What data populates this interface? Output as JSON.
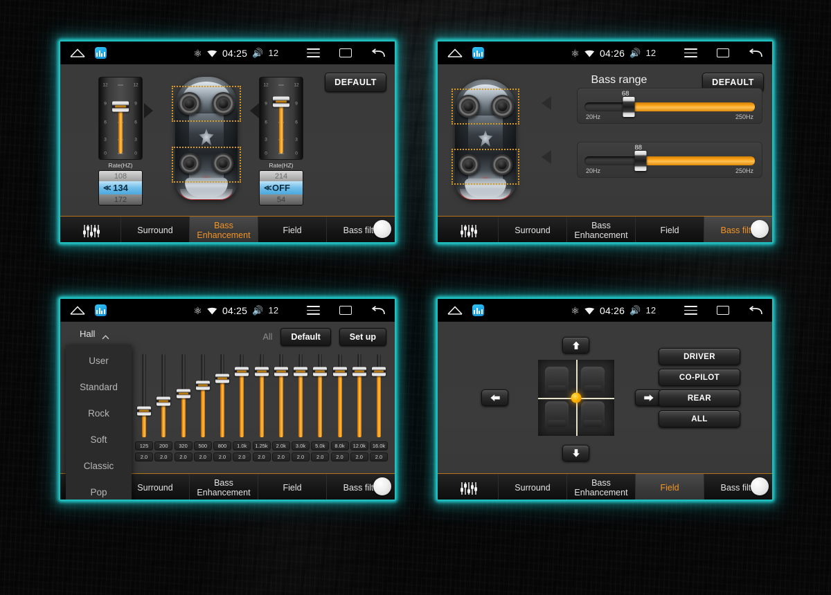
{
  "statusbar": {
    "home_icon": "home-icon",
    "app_icon": "equalizer-app-icon",
    "bluetooth_icon": "bluetooth-icon",
    "wifi_icon": "wifi-icon",
    "volume_icon": "volume-icon",
    "menu_icon": "menu-icon",
    "recents_icon": "recents-icon",
    "back_icon": "back-icon",
    "time_early": "04:25",
    "time_late": "04:26",
    "volume_level": "12"
  },
  "tabs": {
    "eq_icon": "equalizer-sliders-icon",
    "surround": "Surround",
    "bass_enhancement_l1": "Bass",
    "bass_enhancement_l2": "Enhancement",
    "field": "Field",
    "bass_filter": "Bass filte"
  },
  "panel1": {
    "default_button": "DEFAULT",
    "left_slider": {
      "rate_label": "Rate(HZ)",
      "ticks": [
        "12",
        "9",
        "6",
        "3",
        "0"
      ],
      "value_above": "108",
      "value_selected": "134",
      "value_below": "172",
      "selected_prefix": "≪",
      "fill_percent": 62
    },
    "right_slider": {
      "rate_label": "Rate(HZ)",
      "ticks": [
        "12",
        "9",
        "6",
        "3",
        "0"
      ],
      "value_above": "214",
      "value_selected": "OFF",
      "value_below": "54",
      "selected_prefix": "≪",
      "fill_percent": 70
    },
    "car_icon": "car-top-view-icon",
    "front_speakers_selection": "front-speakers-dotted-box",
    "rear_speakers_selection": "rear-speakers-dotted-box"
  },
  "panel2": {
    "default_button": "DEFAULT",
    "title": "Bass range",
    "sliders": [
      {
        "value": "68",
        "min_label": "20Hz",
        "max_label": "250Hz",
        "thumb_percent": 26
      },
      {
        "value": "88",
        "min_label": "20Hz",
        "max_label": "250Hz",
        "thumb_percent": 33
      }
    ],
    "car_icon": "car-top-view-icon"
  },
  "panel3": {
    "preset_selected": "Hall",
    "caret_icon": "chevron-up-icon",
    "preset_options": [
      "User",
      "Standard",
      "Rock",
      "Soft",
      "Classic",
      "Pop"
    ],
    "all_label": "All",
    "default_button": "Default",
    "setup_button": "Set up",
    "bands": [
      "125",
      "200",
      "320",
      "500",
      "800",
      "1.0k",
      "1.25k",
      "2.0k",
      "3.0k",
      "5.0k",
      "8.0k",
      "12.0k",
      "16.0k"
    ],
    "values": [
      "2.0",
      "2.0",
      "2.0",
      "2.0",
      "2.0",
      "2.0",
      "2.0",
      "2.0",
      "2.0",
      "2.0",
      "2.0",
      "2.0",
      "2.0"
    ],
    "thumb_positions": [
      68,
      57,
      48,
      38,
      30,
      22,
      22,
      22,
      22,
      22,
      22,
      22,
      22
    ]
  },
  "panel4": {
    "up_icon": "arrow-up-icon",
    "down_icon": "arrow-down-icon",
    "left_icon": "arrow-left-icon",
    "right_icon": "arrow-right-icon",
    "position_marker": "sound-field-position-dot",
    "seats_icon": "car-seats-icon",
    "buttons": [
      "DRIVER",
      "CO-PILOT",
      "REAR",
      "ALL"
    ]
  },
  "colors": {
    "accent_orange": "#f39425",
    "glow_teal": "#1fbfc0",
    "slider_orange": "#ffa51e",
    "selection_blue": "#73c0ea"
  }
}
